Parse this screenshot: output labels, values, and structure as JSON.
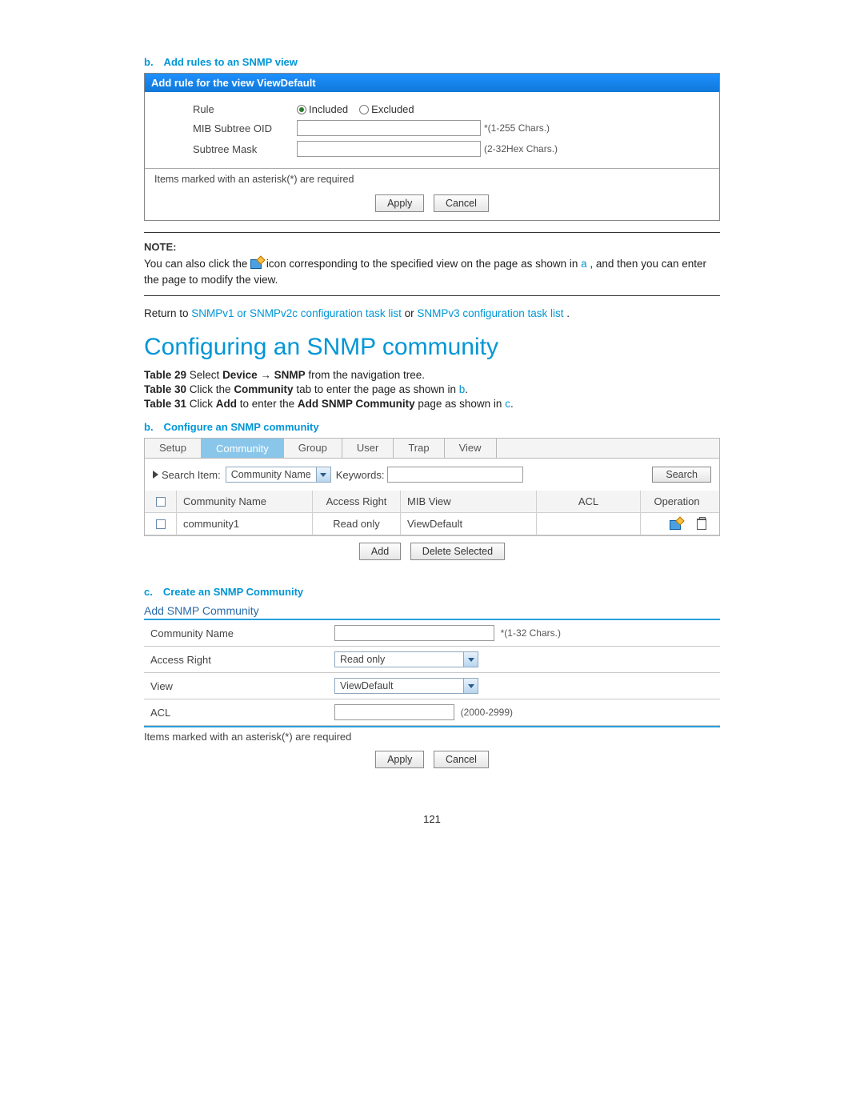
{
  "page_number": "121",
  "section_b": {
    "caption": "b. Add rules to an SNMP view",
    "panel_title": "Add rule for the view ViewDefault",
    "row_rule_label": "Rule",
    "radio_included": "Included",
    "radio_excluded": "Excluded",
    "row_oid_label": "MIB Subtree OID",
    "oid_hint": "*(1-255 Chars.)",
    "row_mask_label": "Subtree Mask",
    "mask_hint": "(2-32Hex Chars.)",
    "req_note": "Items marked with an asterisk(*) are required",
    "apply": "Apply",
    "cancel": "Cancel"
  },
  "note": {
    "label": "NOTE:",
    "pre": "You can also click the ",
    "mid": " icon corresponding to the specified view on the page as shown in ",
    "ref": "a",
    "post": ", and then you can enter the page to modify the view."
  },
  "return_line": {
    "pre": "Return to ",
    "link1": "SNMPv1 or SNMPv2c configuration task list",
    "or": " or ",
    "link2": "SNMPv3 configuration task list",
    "end": "."
  },
  "heading": "Configuring an SNMP community",
  "steps": {
    "t29_a": "Table 29",
    "t29_b": " Select ",
    "t29_c": "Device",
    "t29_d": " → ",
    "t29_e": "SNMP",
    "t29_f": " from the navigation tree.",
    "t30_a": "Table 30",
    "t30_b": " Click the ",
    "t30_c": "Community",
    "t30_d": " tab to enter the page as shown in ",
    "t30_ref": "b",
    "t30_e": ".",
    "t31_a": "Table 31",
    "t31_b": " Click ",
    "t31_c": "Add",
    "t31_d": " to enter the ",
    "t31_e": "Add SNMP Community",
    "t31_f": " page as shown in ",
    "t31_ref": "c",
    "t31_g": "."
  },
  "comm": {
    "caption": "b. Configure an SNMP community",
    "tabs": [
      "Setup",
      "Community",
      "Group",
      "User",
      "Trap",
      "View"
    ],
    "search_label": "Search Item:",
    "search_dropdown": "Community Name",
    "keywords_label": "Keywords:",
    "search_btn": "Search",
    "head": [
      "",
      "Community Name",
      "Access Right",
      "MIB View",
      "ACL",
      "Operation"
    ],
    "row": {
      "name": "community1",
      "access": "Read only",
      "mib": "ViewDefault",
      "acl": ""
    },
    "add_btn": "Add",
    "delete_btn": "Delete Selected"
  },
  "create": {
    "caption": "c. Create an SNMP Community",
    "panel_title": "Add SNMP Community",
    "name_label": "Community Name",
    "name_hint": "*(1-32 Chars.)",
    "access_label": "Access Right",
    "access_value": "Read only",
    "view_label": "View",
    "view_value": "ViewDefault",
    "acl_label": "ACL",
    "acl_hint": "(2000-2999)",
    "req_note": "Items marked with an asterisk(*) are required",
    "apply": "Apply",
    "cancel": "Cancel"
  }
}
